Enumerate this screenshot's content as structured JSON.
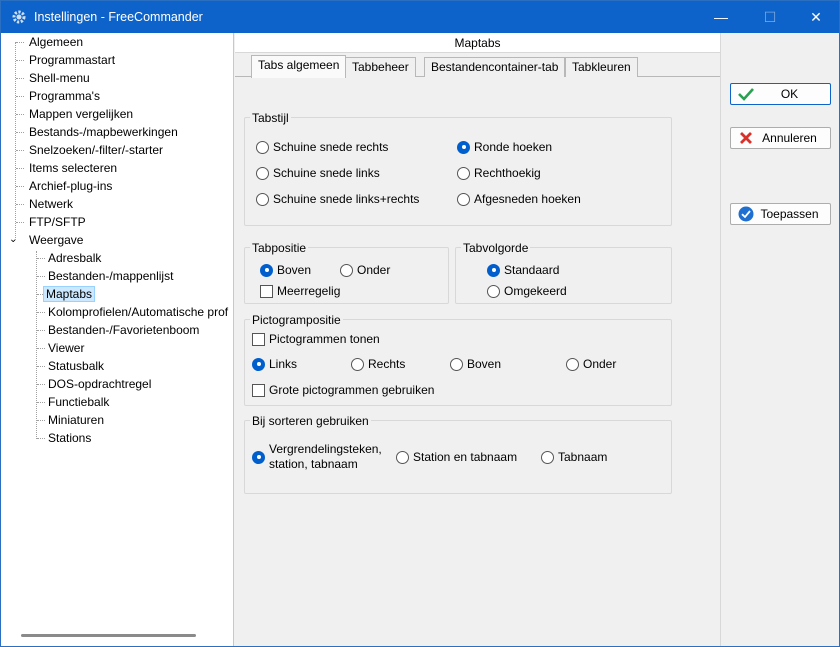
{
  "window": {
    "title": "Instellingen - FreeCommander",
    "minimize": "—",
    "maximize": "☐",
    "close": "✕"
  },
  "tree": {
    "items": [
      {
        "label": "Algemeen"
      },
      {
        "label": "Programmastart"
      },
      {
        "label": "Shell-menu"
      },
      {
        "label": "Programma's"
      },
      {
        "label": "Mappen vergelijken"
      },
      {
        "label": "Bestands-/mapbewerkingen"
      },
      {
        "label": "Snelzoeken/-filter/-starter"
      },
      {
        "label": "Items selecteren"
      },
      {
        "label": "Archief-plug-ins"
      },
      {
        "label": "Netwerk"
      },
      {
        "label": "FTP/SFTP"
      },
      {
        "label": "Weergave",
        "expanded": true
      }
    ],
    "children": [
      {
        "label": "Adresbalk"
      },
      {
        "label": "Bestanden-/mappenlijst"
      },
      {
        "label": "Maptabs",
        "selected": true
      },
      {
        "label": "Kolomprofielen/Automatische prof"
      },
      {
        "label": "Bestanden-/Favorietenboom"
      },
      {
        "label": "Viewer"
      },
      {
        "label": "Statusbalk"
      },
      {
        "label": "DOS-opdrachtregel"
      },
      {
        "label": "Functiebalk"
      },
      {
        "label": "Miniaturen"
      },
      {
        "label": "Stations"
      }
    ]
  },
  "main": {
    "header": "Maptabs",
    "tabs": [
      {
        "label": "Tabs algemeen",
        "active": true
      },
      {
        "label": "Tabbeheer"
      },
      {
        "label": "Bestandencontainer-tab"
      },
      {
        "label": "Tabkleuren"
      }
    ],
    "tabstijl": {
      "title": "Tabstijl",
      "options": [
        {
          "label": "Schuine snede rechts",
          "checked": false
        },
        {
          "label": "Ronde hoeken",
          "checked": true
        },
        {
          "label": "Schuine snede links",
          "checked": false
        },
        {
          "label": "Rechthoekig",
          "checked": false
        },
        {
          "label": "Schuine snede links+rechts",
          "checked": false
        },
        {
          "label": "Afgesneden hoeken",
          "checked": false
        }
      ]
    },
    "tabpositie": {
      "title": "Tabpositie",
      "boven": "Boven",
      "onder": "Onder",
      "meerregelig": "Meerregelig"
    },
    "tabvolgorde": {
      "title": "Tabvolgorde",
      "standaard": "Standaard",
      "omgekeerd": "Omgekeerd"
    },
    "pictogrampositie": {
      "title": "Pictogrampositie",
      "tonen": "Pictogrammen tonen",
      "links": "Links",
      "rechts": "Rechts",
      "boven": "Boven",
      "onder": "Onder",
      "groot": "Grote pictogrammen gebruiken"
    },
    "sorteren": {
      "title": "Bij sorteren gebruiken",
      "opt1_line1": "Vergrendelingsteken,",
      "opt1_line2": "station, tabnaam",
      "opt2": "Station en tabnaam",
      "opt3": "Tabnaam"
    }
  },
  "buttons": {
    "ok": "OK",
    "cancel": "Annuleren",
    "apply": "Toepassen"
  },
  "colors": {
    "titlebar": "#0d63c9",
    "accent": "#005fcc",
    "ok_icon": "#2aa052",
    "cancel_icon": "#d9302a",
    "apply_icon": "#1e6fd0"
  }
}
